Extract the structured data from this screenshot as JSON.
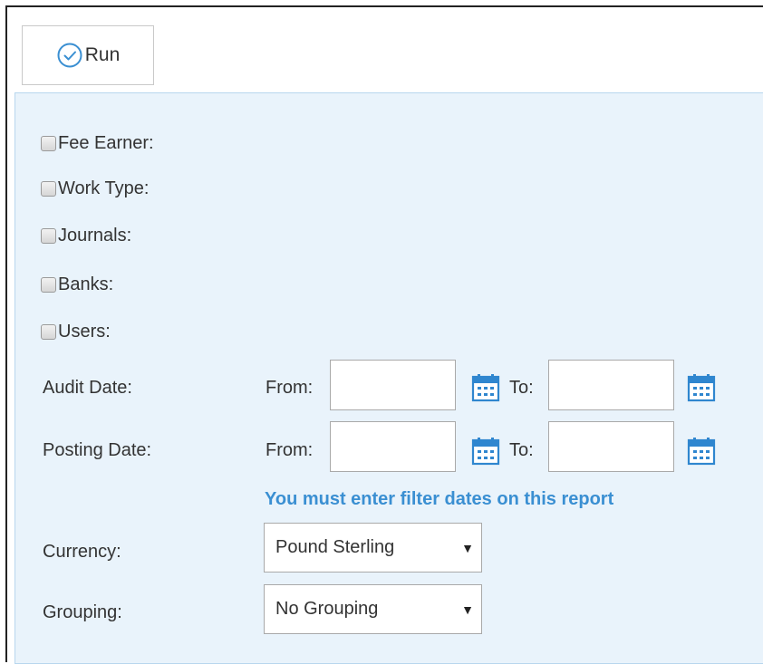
{
  "toolbar": {
    "run_label": "Run",
    "run_icon": "check-circle-icon"
  },
  "filters": {
    "checkboxes": [
      {
        "label": "Fee Earner:",
        "checked": false
      },
      {
        "label": "Work Type:",
        "checked": false
      },
      {
        "label": "Journals:",
        "checked": false
      },
      {
        "label": "Banks:",
        "checked": false
      },
      {
        "label": "Users:",
        "checked": false
      }
    ],
    "audit_date": {
      "label": "Audit Date:",
      "from_label": "From:",
      "to_label": "To:",
      "from_value": "",
      "to_value": ""
    },
    "posting_date": {
      "label": "Posting Date:",
      "from_label": "From:",
      "to_label": "To:",
      "from_value": "",
      "to_value": ""
    },
    "warning": "You must enter filter dates on this report",
    "currency": {
      "label": "Currency:",
      "value": "Pound Sterling"
    },
    "grouping": {
      "label": "Grouping:",
      "value": "No Grouping"
    },
    "calendar_icon": "calendar-icon"
  },
  "colors": {
    "panel_bg": "#e9f3fb",
    "panel_border": "#b8d6ee",
    "accent": "#3a8fd2",
    "text": "#333333"
  }
}
